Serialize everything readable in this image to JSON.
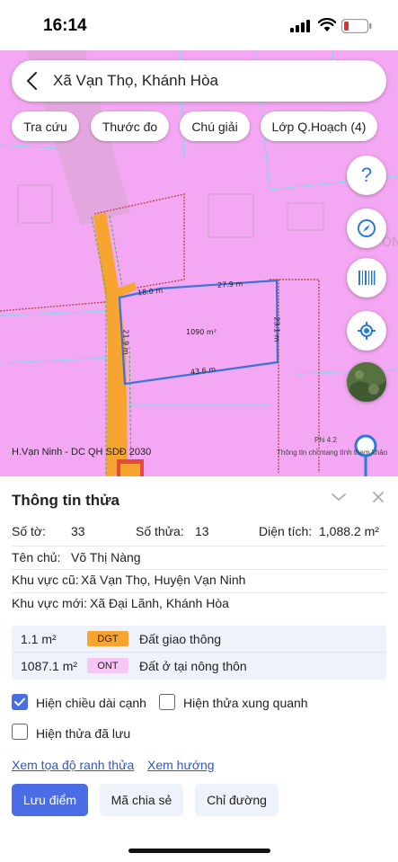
{
  "status": {
    "time": "16:14"
  },
  "search": {
    "title": "Xã Vạn Thọ, Khánh Hòa"
  },
  "chips": [
    "Tra cứu",
    "Thước đo",
    "Chú giải",
    "Lớp Q.Hoạch (4)"
  ],
  "fabs": {
    "help": "?"
  },
  "map": {
    "caption": "H.Vạn Ninh - DC QH SDĐ 2030",
    "credit": "Thông tin chỉ mang tính tham khảo",
    "credit_partial": "Phi 4.2",
    "edge_top": "18.0 m",
    "edge_top2": "27.9 m",
    "edge_right": "23.1 m",
    "edge_bottom": "43.6 m",
    "edge_left": "21.9 m",
    "area_label": "1090 m²",
    "faint_text": "ONT"
  },
  "sheet": {
    "title": "Thông tin thửa",
    "so_to_label": "Số tờ:",
    "so_to_value": "33",
    "so_thua_label": "Số thửa:",
    "so_thua_value": "13",
    "dien_tich_label": "Diện tích:",
    "dien_tich_value": "1,088.2 m²",
    "chu_label": "Tên chủ:",
    "chu_value": "Võ Thị Nàng",
    "kv_cu_label": "Khu vực cũ:",
    "kv_cu_value": "Xã Vạn Thọ, Huyện Vạn Ninh",
    "kv_moi_label": "Khu vực mới:",
    "kv_moi_value": "Xã Đại Lãnh, Khánh Hòa",
    "land": [
      {
        "area": "1.1 m²",
        "code": "DGT",
        "desc": "Đất giao thông",
        "color": "#f7a530"
      },
      {
        "area": "1087.1 m²",
        "code": "ONT",
        "desc": "Đất ở tại nông thôn",
        "color": "#f7c6f5"
      }
    ],
    "cb1": "Hiện chiều dài cạnh",
    "cb2": "Hiện thửa xung quanh",
    "cb3": "Hiện thửa đã lưu",
    "link1": "Xem tọa độ ranh thửa",
    "link2": "Xem hướng",
    "btn_save": "Lưu điểm",
    "btn_share": "Mã chia sẻ",
    "btn_route": "Chỉ đường"
  },
  "colors": {
    "accent": "#4a6de5",
    "map_pink": "#f4a7f2",
    "road_orange": "#f7a530",
    "parcel_blue": "#3a73d9"
  }
}
